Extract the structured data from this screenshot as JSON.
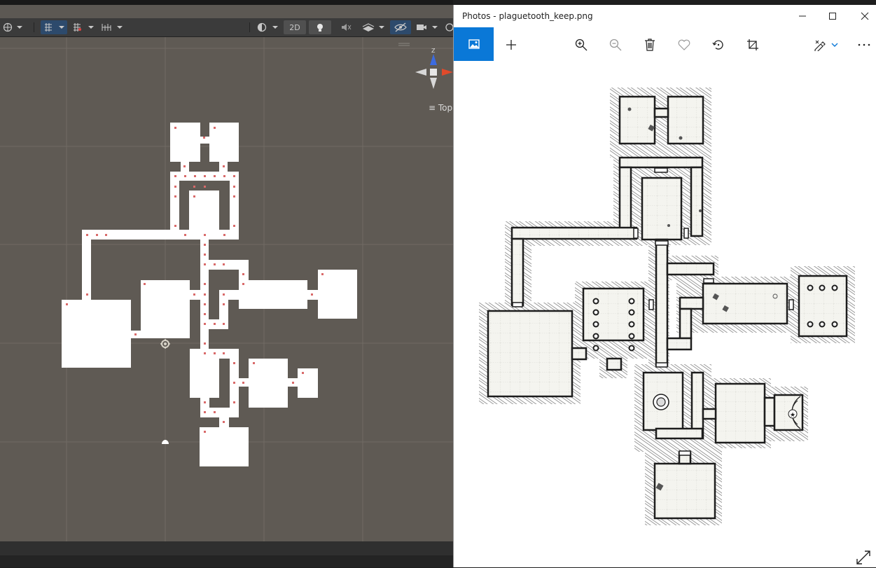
{
  "editor": {
    "toolbar": {
      "view_mode_label": "2D",
      "orientation_label": "Top",
      "gizmo_axis_label": "Z"
    }
  },
  "photos": {
    "title": "Photos - plaguetooth_keep.png",
    "toolbar": {
      "items": [
        "image-icon",
        "add-icon",
        "zoom-in-icon",
        "zoom-out-icon",
        "delete-icon",
        "favorite-icon",
        "rotate-icon",
        "crop-icon",
        "edit-icon",
        "more-icon"
      ]
    },
    "window_controls": [
      "minimize-icon",
      "maximize-icon",
      "close-icon"
    ]
  },
  "colors": {
    "editor_background": "#5f5a54",
    "accent": "#0a78d7",
    "toolbar_active": "#2d4a6c"
  }
}
